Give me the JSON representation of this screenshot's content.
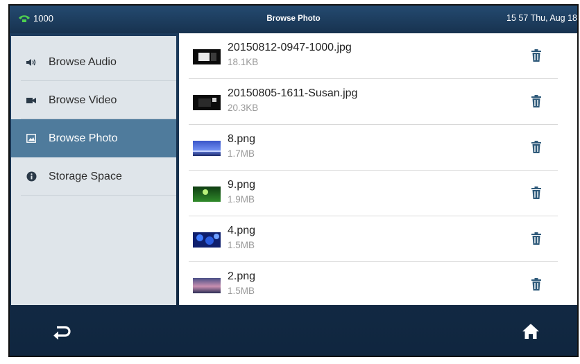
{
  "status_bar": {
    "line_icon": "phone-icon",
    "line_number": "1000",
    "title": "Browse Photo",
    "datetime": "15 57 Thu, Aug 18"
  },
  "sidebar": {
    "items": [
      {
        "label": "Browse Audio",
        "icon": "speaker-icon",
        "active": false
      },
      {
        "label": "Browse Video",
        "icon": "video-camera-icon",
        "active": false
      },
      {
        "label": "Browse Photo",
        "icon": "photo-icon",
        "active": true
      },
      {
        "label": "Storage Space",
        "icon": "info-icon",
        "active": false
      }
    ]
  },
  "photos": [
    {
      "name": "20150812-0947-1000.jpg",
      "size": "18.1KB",
      "thumb": "dark-screenshot-thumbnail"
    },
    {
      "name": "20150805-1611-Susan.jpg",
      "size": "20.3KB",
      "thumb": "dark-screenshot-thumbnail"
    },
    {
      "name": "8.png",
      "size": "1.7MB",
      "thumb": "blue-sky-thumbnail"
    },
    {
      "name": "9.png",
      "size": "1.9MB",
      "thumb": "green-landscape-thumbnail"
    },
    {
      "name": "4.png",
      "size": "1.5MB",
      "thumb": "blue-flowers-thumbnail"
    },
    {
      "name": "2.png",
      "size": "1.5MB",
      "thumb": "purple-sunset-thumbnail"
    }
  ],
  "bottom_bar": {
    "back_icon": "back-arrow-icon",
    "home_icon": "home-icon"
  },
  "colors": {
    "accent_active": "#4f7b9c",
    "trash_icon": "#2f5a7a",
    "status_bar": "#1d3d5f"
  }
}
